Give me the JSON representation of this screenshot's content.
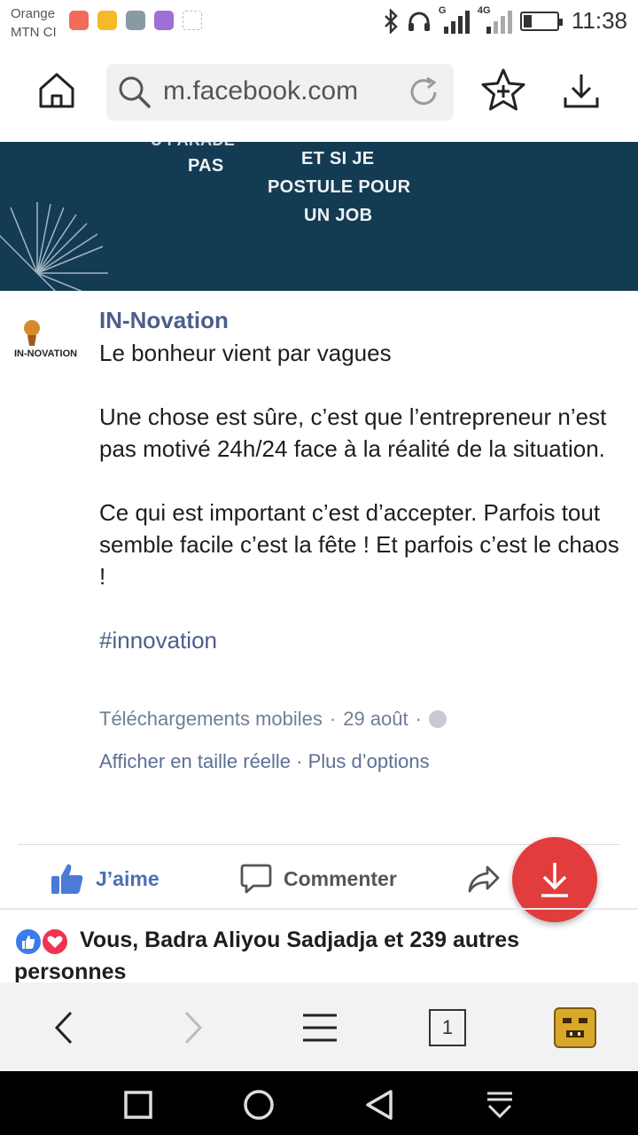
{
  "status_bar": {
    "carrier_line1": "Orange",
    "carrier_line2": "MTN CI",
    "network_g": "G",
    "network_4g": "4G",
    "battery_level": 0.25,
    "time": "11:38"
  },
  "toolbar": {
    "url": "m.facebook.com",
    "icons": [
      "home-icon",
      "search-icon",
      "reload-icon",
      "star-add-icon",
      "download-icon"
    ]
  },
  "hero": {
    "cut_text": "U PARADE",
    "left_text": "PAS",
    "right_line1": "ET SI JE",
    "right_line2": "POSTULE POUR",
    "right_line3": "UN JOB",
    "background_color": "#143b54"
  },
  "post": {
    "author": "IN-Novation",
    "logo_text": "IN-NOVATION",
    "paragraph1": "Le bonheur vient par vagues",
    "paragraph2": "Une chose est sûre, c’est que l’entrepreneur n’est pas motivé 24h/24 face à la réalité de la situation.",
    "paragraph3": "Ce qui est important c’est d’accepter. Parfois tout semble facile c’est la fête ! Et parfois c’est le chaos !",
    "hashtag": "#innovation",
    "album": "Téléchargements mobiles",
    "separator": "·",
    "date": "29 août",
    "view_full": "Afficher en taille réelle",
    "more_options": "Plus d’options"
  },
  "actions": {
    "like_label": "J’aime",
    "comment_label": "Commenter",
    "like_color": "#4b6fb8"
  },
  "reactions": {
    "text": "Vous, Badra Aliyou Sadjadja et 239 autres personnes"
  },
  "bottom_bar": {
    "tab_count": "1"
  },
  "colors": {
    "fab": "#e23c3c",
    "link": "#4b5f8b"
  }
}
